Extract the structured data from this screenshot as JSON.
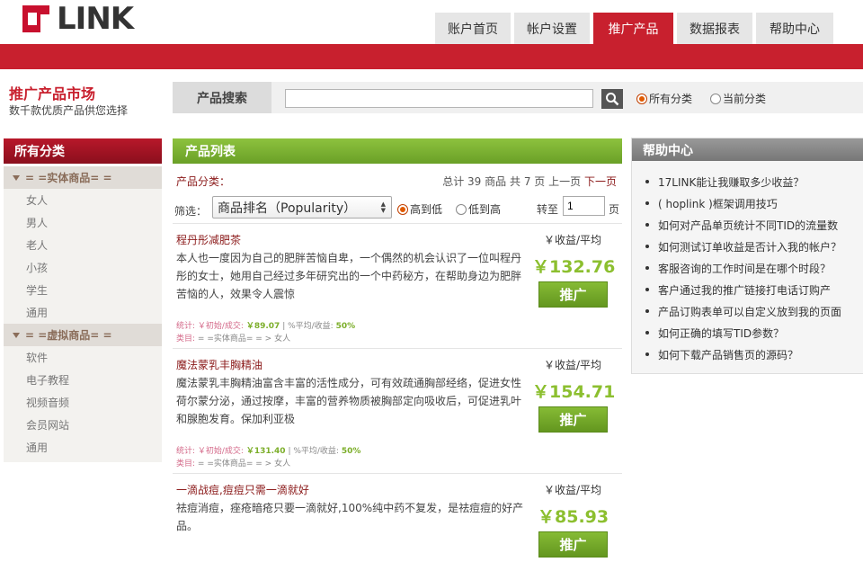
{
  "logo": {
    "text": "LINK"
  },
  "nav": {
    "tabs": [
      {
        "label": "账户首页",
        "active": false
      },
      {
        "label": "帐户设置",
        "active": false
      },
      {
        "label": "推广产品",
        "active": true
      },
      {
        "label": "数据报表",
        "active": false
      },
      {
        "label": "帮助中心",
        "active": false
      }
    ]
  },
  "market": {
    "title": "推广产品市场",
    "subtitle": "数千款优质产品供您选择"
  },
  "search": {
    "label": "产品搜索",
    "value": "",
    "scope_all": "所有分类",
    "scope_current": "当前分类",
    "selected_scope": "all"
  },
  "sidebar": {
    "title": "所有分类",
    "groups": [
      {
        "label": "= =实体商品= =",
        "items": [
          "女人",
          "男人",
          "老人",
          "小孩",
          "学生",
          "通用"
        ]
      },
      {
        "label": "= =虚拟商品= =",
        "items": [
          "软件",
          "电子教程",
          "视频音频",
          "会员网站",
          "通用"
        ]
      }
    ]
  },
  "product_list": {
    "title": "产品列表",
    "category_label": "产品分类：",
    "pager": {
      "total_prefix": "总计",
      "total": "39",
      "unit_goods": "商品",
      "pages_prefix": "共",
      "pages": "7",
      "unit_pages": "页",
      "prev": "上一页",
      "next": "下一页"
    },
    "filter": {
      "label": "筛选：",
      "sort_value": "商品排名（Popularity）",
      "high_to_low": "高到低",
      "low_to_high": "低到高",
      "jump_label": "转至",
      "jump_value": "1",
      "jump_unit": "页"
    },
    "products": [
      {
        "name": "程丹彤减肥茶",
        "description": "本人也一度因为自己的肥胖苦恼自卑，一个偶然的机会认识了一位叫程丹彤的女士，她用自己经过多年研究出的一个中药秘方，在帮助身边为肥胖苦恼的人，效果令人震惊",
        "price_label": "￥收益/平均",
        "price": "￥132.76",
        "button": "推广",
        "stats_label": "统计: ￥初始/成交:",
        "stats_value": "￥89.07",
        "stats_mid": "| %平均/收益:",
        "stats_pct": "50%",
        "category_label": "类目:",
        "category_path": "= =实体商品= = > 女人"
      },
      {
        "name": "魔法蒙乳丰胸精油",
        "description": "魔法蒙乳丰胸精油富含丰富的活性成分，可有效疏通胸部经络，促进女性荷尔蒙分泌，通过按摩，丰富的营养物质被胸部定向吸收后，可促进乳叶和腺胞发育。保加利亚极",
        "price_label": "￥收益/平均",
        "price": "￥154.71",
        "button": "推广",
        "stats_label": "统计: ￥初始/成交:",
        "stats_value": "￥131.40",
        "stats_mid": "| %平均/收益:",
        "stats_pct": "50%",
        "category_label": "类目:",
        "category_path": "= =实体商品= = > 女人"
      },
      {
        "name": "一滴战痘,痘痘只需一滴就好",
        "description": "祛痘消痘，痤疮暗疮只要一滴就好,100%纯中药不复发，是祛痘痘的好产品。",
        "price_label": "￥收益/平均",
        "price": "￥85.93",
        "button": "推广",
        "stats_label": "",
        "stats_value": "",
        "stats_mid": "",
        "stats_pct": "",
        "category_label": "",
        "category_path": ""
      }
    ]
  },
  "help": {
    "title": "帮助中心",
    "items": [
      "17LINK能让我赚取多少收益？",
      "( hoplink )框架调用技巧",
      "如何对产品单页统计不同TID的流量数",
      "如何测试订单收益是否计入我的帐户？",
      "客服咨询的工作时间是在哪个时段？",
      "客户通过我的推广链接打电话订购产",
      "产品订购表单可以自定义放到我的页面",
      "如何正确的填写TID参数？",
      "如何下载产品销售页的源码？"
    ]
  }
}
